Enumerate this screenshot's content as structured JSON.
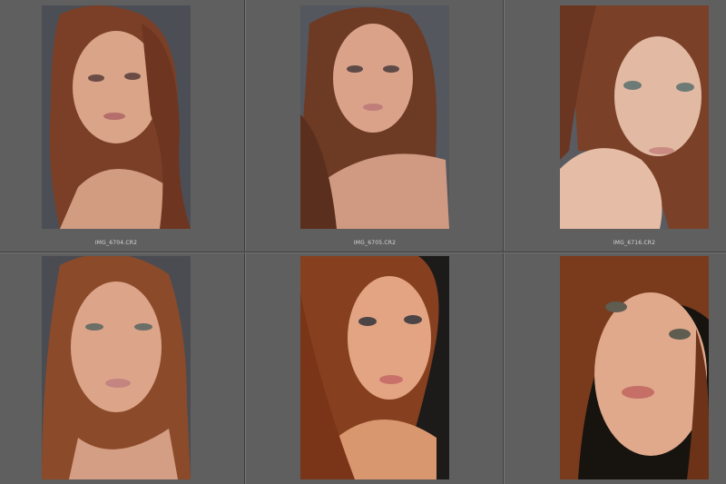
{
  "grid": {
    "columns": 3,
    "rows": 2
  },
  "photos": [
    {
      "filename": "IMG_6704.CR2",
      "bg": "#4c4e55",
      "hair": "#7a3f26",
      "skin": "#d9a487"
    },
    {
      "filename": "IMG_6705.CR2",
      "bg": "#55575e",
      "hair": "#6d3a24",
      "skin": "#dba28a"
    },
    {
      "filename": "IMG_6716.CR2",
      "bg": "#5a5b60",
      "hair": "#7a4028",
      "skin": "#e2b9a3"
    },
    {
      "filename": "",
      "bg": "#4a4c52",
      "hair": "#8b4a2a",
      "skin": "#dca58a"
    },
    {
      "filename": "",
      "bg": "#1d1a1a",
      "hair": "#86401f",
      "skin": "#e2a482"
    },
    {
      "filename": "",
      "bg": "#17130f",
      "hair": "#7a3a1c",
      "skin": "#e0a98c"
    }
  ],
  "colors": {
    "panel_bg": "#5f5f5f",
    "separator": "#3e3e3e",
    "caption_text": "#d8d8d8"
  }
}
